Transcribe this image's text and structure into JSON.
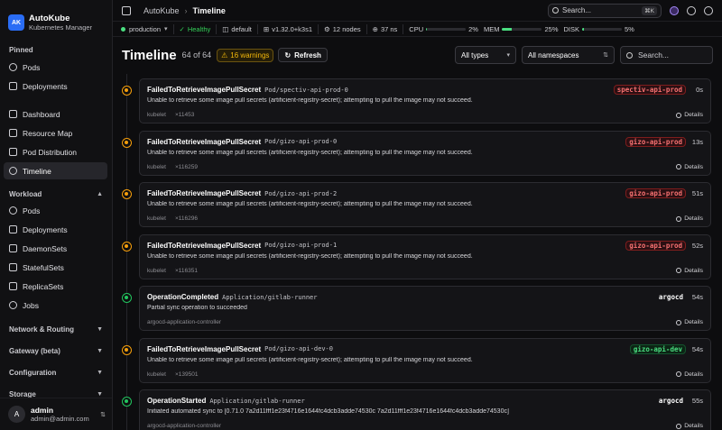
{
  "brand": {
    "logo": "AK",
    "name": "AutoKube",
    "subtitle": "Kubernetes Manager"
  },
  "sidebar": {
    "pinned_label": "Pinned",
    "pinned": [
      {
        "label": "Pods",
        "icon": "pods-icon"
      },
      {
        "label": "Deployments",
        "icon": "deployments-icon"
      }
    ],
    "main": [
      {
        "label": "Dashboard",
        "icon": "dashboard-icon"
      },
      {
        "label": "Resource Map",
        "icon": "resource-map-icon"
      },
      {
        "label": "Pod Distribution",
        "icon": "pod-distribution-icon"
      },
      {
        "label": "Timeline",
        "icon": "timeline-icon",
        "active": true
      }
    ],
    "workload_label": "Workload",
    "workload": [
      {
        "label": "Pods",
        "icon": "pods-icon"
      },
      {
        "label": "Deployments",
        "icon": "deployments-icon"
      },
      {
        "label": "DaemonSets",
        "icon": "daemonsets-icon"
      },
      {
        "label": "StatefulSets",
        "icon": "statefulsets-icon"
      },
      {
        "label": "ReplicaSets",
        "icon": "replicasets-icon"
      },
      {
        "label": "Jobs",
        "icon": "jobs-icon"
      }
    ],
    "sections": [
      "Network & Routing",
      "Gateway (beta)",
      "Configuration",
      "Storage"
    ]
  },
  "user": {
    "initial": "A",
    "name": "admin",
    "email": "admin@admin.com"
  },
  "topbar": {
    "crumb_root": "AutoKube",
    "crumb_current": "Timeline",
    "search_placeholder": "Search...",
    "shortcut": "⌘K"
  },
  "status": {
    "cluster": "production",
    "health": "Healthy",
    "namespace": "default",
    "version": "v1.32.0+k3s1",
    "nodes": "12 nodes",
    "ns_count": "37 ns",
    "cpu_label": "CPU",
    "cpu_value": "2%",
    "cpu_pct": 2,
    "mem_label": "MEM",
    "mem_value": "25%",
    "mem_pct": 25,
    "disk_label": "DISK",
    "disk_value": "5%",
    "disk_pct": 5,
    "accent": "#4ade80"
  },
  "page": {
    "title": "Timeline",
    "count": "64 of 64",
    "warnings": "16 warnings",
    "refresh": "Refresh",
    "type_filter": "All types",
    "ns_filter": "All namespaces",
    "search_placeholder": "Search..."
  },
  "details_label": "Details",
  "events": [
    {
      "kind": "warn",
      "reason": "FailedToRetrieveImagePullSecret",
      "object": "Pod/spectiv-api-prod-0",
      "namespace": "spectiv-api-prod",
      "ns_style": "red",
      "age": "0s",
      "message": "Unable to retrieve some image pull secrets (artificient-registry-secret); attempting to pull the image may not succeed.",
      "source": "kubelet",
      "count": "×11453"
    },
    {
      "kind": "warn",
      "reason": "FailedToRetrieveImagePullSecret",
      "object": "Pod/gizo-api-prod-0",
      "namespace": "gizo-api-prod",
      "ns_style": "red",
      "age": "13s",
      "message": "Unable to retrieve some image pull secrets (artificient-registry-secret); attempting to pull the image may not succeed.",
      "source": "kubelet",
      "count": "×116259"
    },
    {
      "kind": "warn",
      "reason": "FailedToRetrieveImagePullSecret",
      "object": "Pod/gizo-api-prod-2",
      "namespace": "gizo-api-prod",
      "ns_style": "red",
      "age": "51s",
      "message": "Unable to retrieve some image pull secrets (artificient-registry-secret); attempting to pull the image may not succeed.",
      "source": "kubelet",
      "count": "×116296"
    },
    {
      "kind": "warn",
      "reason": "FailedToRetrieveImagePullSecret",
      "object": "Pod/gizo-api-prod-1",
      "namespace": "gizo-api-prod",
      "ns_style": "red",
      "age": "52s",
      "message": "Unable to retrieve some image pull secrets (artificient-registry-secret); attempting to pull the image may not succeed.",
      "source": "kubelet",
      "count": "×116351"
    },
    {
      "kind": "ok",
      "reason": "OperationCompleted",
      "object": "Application/gitlab-runner",
      "namespace": "argocd",
      "ns_style": "plain",
      "age": "54s",
      "message": "Partial sync operation to succeeded",
      "source": "argocd-application-controller",
      "count": ""
    },
    {
      "kind": "warn",
      "reason": "FailedToRetrieveImagePullSecret",
      "object": "Pod/gizo-api-dev-0",
      "namespace": "gizo-api-dev",
      "ns_style": "green",
      "age": "54s",
      "message": "Unable to retrieve some image pull secrets (artificient-registry-secret); attempting to pull the image may not succeed.",
      "source": "kubelet",
      "count": "×139501"
    },
    {
      "kind": "ok",
      "reason": "OperationStarted",
      "object": "Application/gitlab-runner",
      "namespace": "argocd",
      "ns_style": "plain",
      "age": "55s",
      "message": "Initiated automated sync to [0.71.0 7a2d11fff1e23f4716e1644fc4dcb3adde74530c 7a2d11fff1e23f4716e1644fc4dcb3adde74530c]",
      "source": "argocd-application-controller",
      "count": ""
    }
  ]
}
